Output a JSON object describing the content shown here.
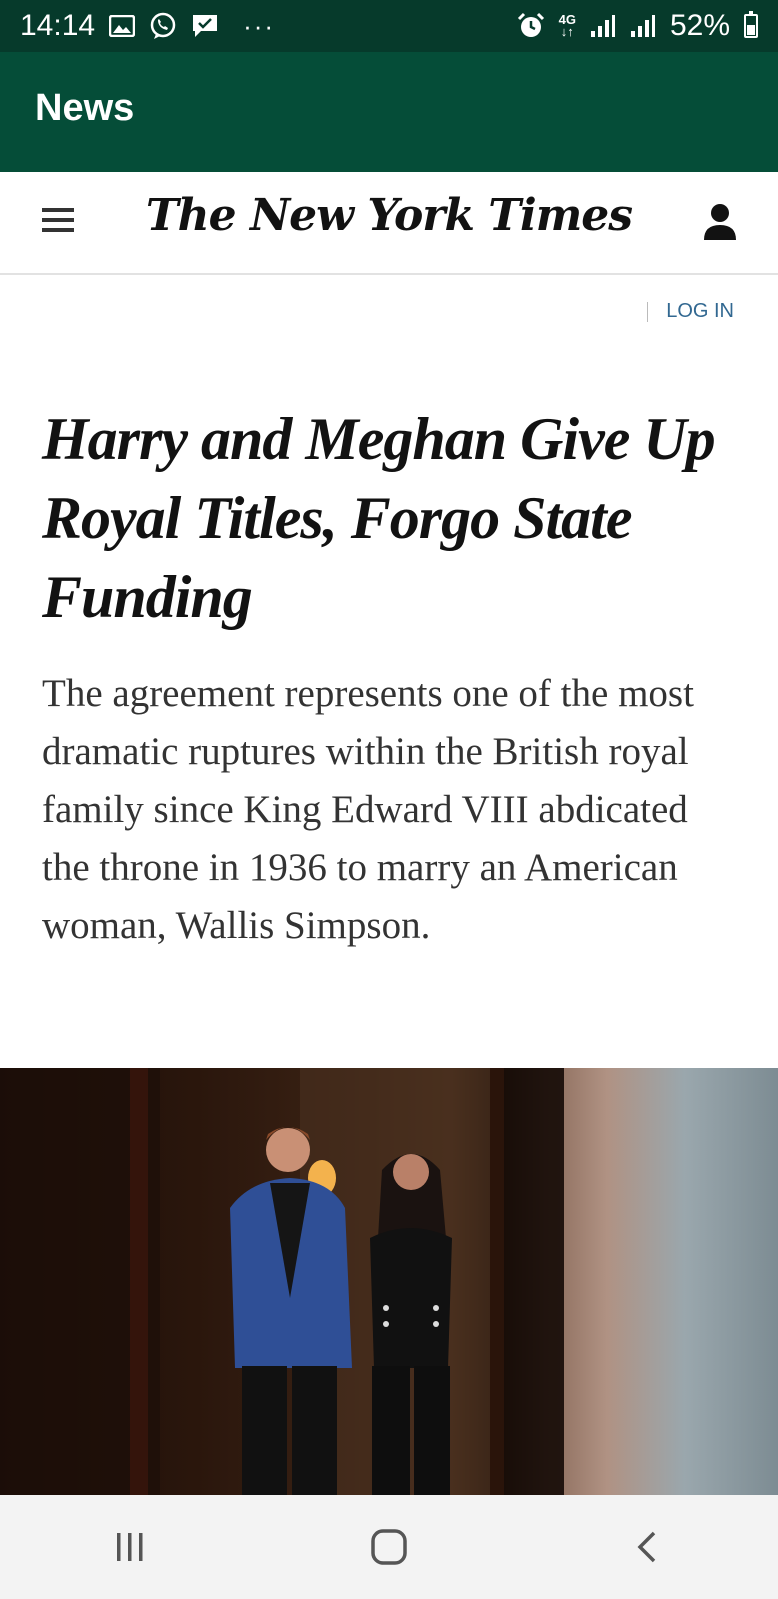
{
  "status_bar": {
    "time": "14:14",
    "more": "···",
    "network": "4G",
    "battery": "52%"
  },
  "app_bar": {
    "title": "News"
  },
  "nyt": {
    "logo": "The New York Times",
    "login": "LOG IN"
  },
  "article": {
    "headline": "Harry and Meghan Give Up Royal Titles, Forgo State Funding",
    "summary": "The agreement represents one of the most dramatic ruptures within the British royal family since King Edward VIII abdicated the throne in 1936 to marry an American woman, Wallis Simpson."
  },
  "colors": {
    "status_bar": "#063a2b",
    "app_bar": "#054d38",
    "link": "#326891"
  },
  "icons": {
    "status_left": [
      "image-icon",
      "viber-icon",
      "chat-icon"
    ],
    "status_right": [
      "alarm-icon",
      "signal-icon",
      "signal-icon",
      "battery-icon"
    ],
    "header": [
      "menu-icon",
      "account-icon"
    ],
    "nav": [
      "recent-apps-icon",
      "home-icon",
      "back-icon"
    ]
  }
}
